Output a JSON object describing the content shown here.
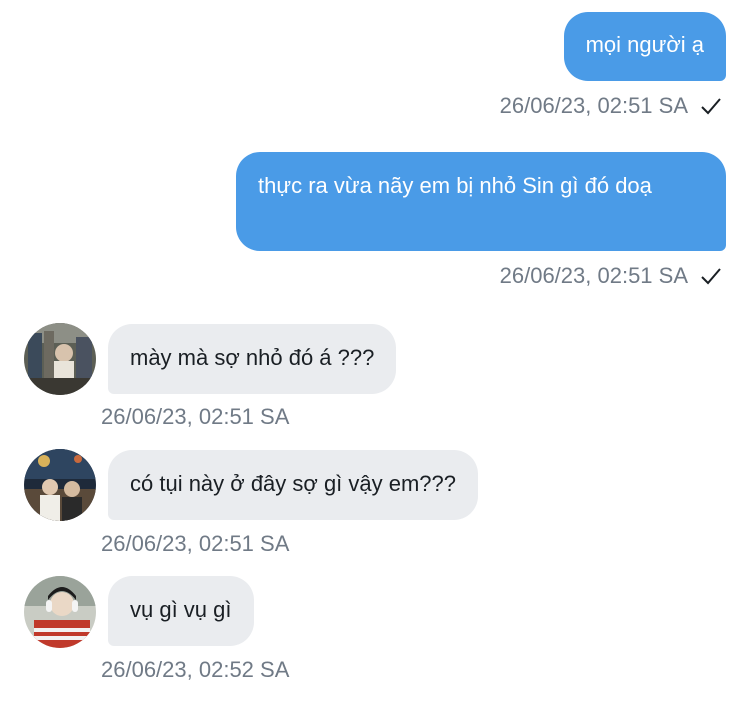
{
  "messages": [
    {
      "text": "mọi người ạ",
      "time": "26/06/23, 02:51 SA",
      "status_icon": "check-icon"
    },
    {
      "text": "thực ra vừa nãy em bị nhỏ Sin gì đó doạ",
      "time": "26/06/23, 02:51 SA",
      "status_icon": "check-icon"
    },
    {
      "text": "mày mà sợ nhỏ đó á ???",
      "time": "26/06/23, 02:51 SA",
      "avatar_icon": "user-avatar-icon"
    },
    {
      "text": "có tụi này ở đây sợ gì vậy em???",
      "time": "26/06/23, 02:51 SA",
      "avatar_icon": "user-avatar-icon"
    },
    {
      "text": "vụ gì vụ gì",
      "time": "26/06/23, 02:52 SA",
      "avatar_icon": "user-avatar-icon"
    }
  ],
  "colors": {
    "outgoing_bubble": "#4a9be7",
    "incoming_bubble": "#eaecef",
    "meta_text": "#707a86"
  }
}
